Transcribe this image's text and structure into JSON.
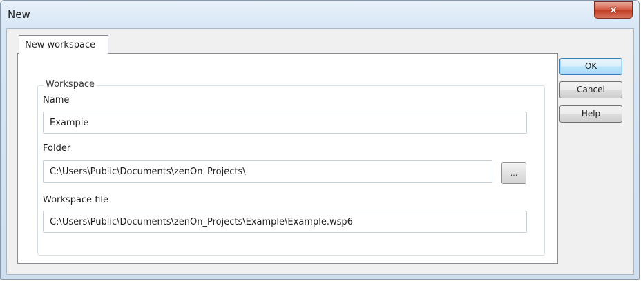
{
  "window": {
    "title": "New",
    "close_glyph": "✕",
    "close_icon": "close-icon"
  },
  "tabs": [
    {
      "label": "New workspace",
      "active": true
    }
  ],
  "workspace_group": {
    "title": "Workspace",
    "name_label": "Name",
    "name_value": "Example",
    "folder_label": "Folder",
    "folder_value": "C:\\Users\\Public\\Documents\\zenOn_Projects\\",
    "browse_label": "...",
    "file_label": "Workspace file",
    "file_value": "C:\\Users\\Public\\Documents\\zenOn_Projects\\Example\\Example.wsp6"
  },
  "buttons": {
    "ok": "OK",
    "cancel": "Cancel",
    "help": "Help"
  },
  "colors": {
    "close_button": "#c13e25",
    "default_button_border": "#3c7fb1",
    "title_bar": "#d7e6f5"
  }
}
